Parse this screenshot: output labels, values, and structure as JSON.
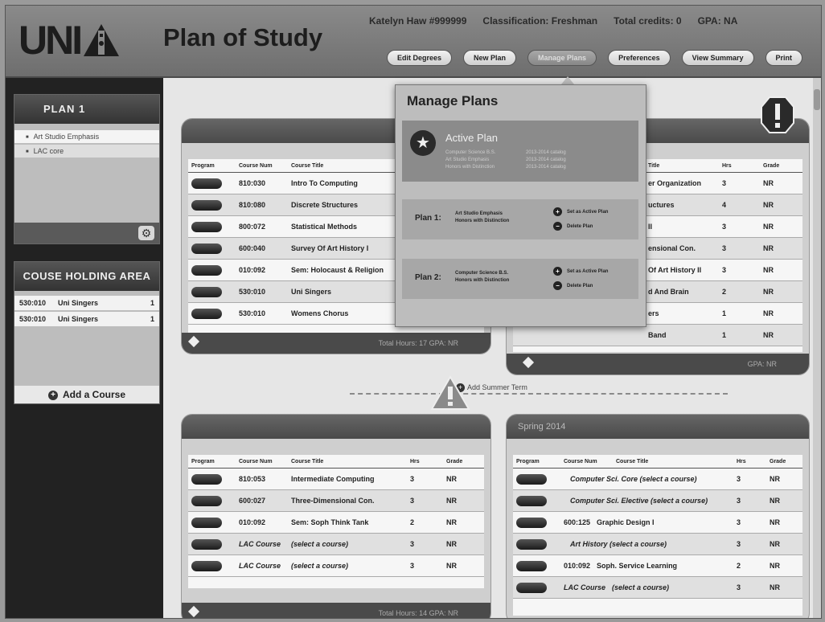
{
  "header": {
    "logo": "UNI",
    "title": "Plan of Study",
    "user": "Katelyn Haw #999999",
    "classification": "Classification: Freshman",
    "credits": "Total credits: 0",
    "gpa": "GPA: NA",
    "nav": [
      "Edit Degrees",
      "New Plan",
      "Manage Plans",
      "Preferences",
      "View Summary",
      "Print"
    ]
  },
  "sidebar": {
    "plan_title": "PLAN 1",
    "emphases": [
      "Art Studio Emphasis",
      "LAC core"
    ],
    "holding_title": "COUSE HOLDING AREA",
    "holding": [
      {
        "num": "530:010",
        "title": "Uni Singers",
        "hrs": "1"
      },
      {
        "num": "530:010",
        "title": "Uni Singers",
        "hrs": "1"
      }
    ],
    "add_course": "Add a Course"
  },
  "terms": {
    "fall": {
      "headers": [
        "Program",
        "Course Num",
        "Course Title"
      ],
      "rows": [
        {
          "num": "810:030",
          "title": "Intro To Computing"
        },
        {
          "num": "810:080",
          "title": "Discrete Structures"
        },
        {
          "num": "800:072",
          "title": "Statistical Methods"
        },
        {
          "num": "600:040",
          "title": "Survey Of Art History I"
        },
        {
          "num": "010:092",
          "title": "Sem: Holocaust & Religion"
        },
        {
          "num": "530:010",
          "title": "Uni Singers"
        },
        {
          "num": "530:010",
          "title": "Womens Chorus"
        }
      ],
      "footer": "Total Hours: 17  GPA: NR"
    },
    "spring": {
      "headers": [
        "Title",
        "Hrs",
        "Grade"
      ],
      "rows": [
        {
          "title": "er Organization",
          "hrs": "3",
          "grade": "NR"
        },
        {
          "title": "uctures",
          "hrs": "4",
          "grade": "NR"
        },
        {
          "title": "II",
          "hrs": "3",
          "grade": "NR"
        },
        {
          "title": "ensional Con.",
          "hrs": "3",
          "grade": "NR"
        },
        {
          "title": "Of Art History II",
          "hrs": "3",
          "grade": "NR"
        },
        {
          "title": "d And Brain",
          "hrs": "2",
          "grade": "NR"
        },
        {
          "title": "ers",
          "hrs": "1",
          "grade": "NR"
        },
        {
          "title": "Band",
          "hrs": "1",
          "grade": "NR"
        }
      ],
      "footer": "GPA: NR"
    },
    "summer_label": "Add Summer Term",
    "fall2": {
      "headers": [
        "Program",
        "Course Num",
        "Course Title",
        "Hrs",
        "Grade"
      ],
      "rows": [
        {
          "num": "810:053",
          "title": "Intermediate Computing",
          "hrs": "3",
          "grade": "NR",
          "italic": false
        },
        {
          "num": "600:027",
          "title": "Three-Dimensional Con.",
          "hrs": "3",
          "grade": "NR",
          "italic": false
        },
        {
          "num": "010:092",
          "title": "Sem: Soph Think Tank",
          "hrs": "2",
          "grade": "NR",
          "italic": false
        },
        {
          "num": "LAC Course",
          "title": "(select a course)",
          "hrs": "3",
          "grade": "NR",
          "italic": true
        },
        {
          "num": "LAC Course",
          "title": "(select a course)",
          "hrs": "3",
          "grade": "NR",
          "italic": true
        }
      ],
      "footer": "Total Hours: 14   GPA: NR"
    },
    "spring2": {
      "title": "Spring 2014",
      "headers": [
        "Program",
        "Course Num",
        "Course Title",
        "Hrs",
        "Grade"
      ],
      "rows": [
        {
          "num": "",
          "title": "Computer Sci. Core (select a course)",
          "hrs": "3",
          "grade": "NR",
          "italic": true
        },
        {
          "num": "",
          "title": "Computer Sci. Elective (select a course)",
          "hrs": "3",
          "grade": "NR",
          "italic": true
        },
        {
          "num": "600:125",
          "title": "Graphic Design I",
          "hrs": "3",
          "grade": "NR",
          "italic": false
        },
        {
          "num": "",
          "title": "Art History (select a course)",
          "hrs": "3",
          "grade": "NR",
          "italic": true
        },
        {
          "num": "010:092",
          "title": "Soph. Service Learning",
          "hrs": "2",
          "grade": "NR",
          "italic": false
        },
        {
          "num": "LAC Course",
          "title": "(select a course)",
          "hrs": "3",
          "grade": "NR",
          "italic": true
        }
      ]
    }
  },
  "popup": {
    "title": "Manage Plans",
    "active_title": "Active Plan",
    "active_rows": [
      {
        "a": "Computer Science B.S.",
        "b": "2013-2014 catalog"
      },
      {
        "a": "Art Studio Emphasis",
        "b": "2013-2014 catalog"
      },
      {
        "a": "Honors with Distinction",
        "b": "2013-2014 catalog"
      }
    ],
    "plans": [
      {
        "label": "Plan 1:",
        "desc1": "Art Studio Emphasis",
        "desc2": "Honors with Distinction",
        "set": "Set as Active Plan",
        "del": "Delete Plan"
      },
      {
        "label": "Plan 2:",
        "desc1": "Computer Science B.S.",
        "desc2": "Honors with Distinction",
        "set": "Set as Active Plan",
        "del": "Delete Plan"
      }
    ]
  }
}
